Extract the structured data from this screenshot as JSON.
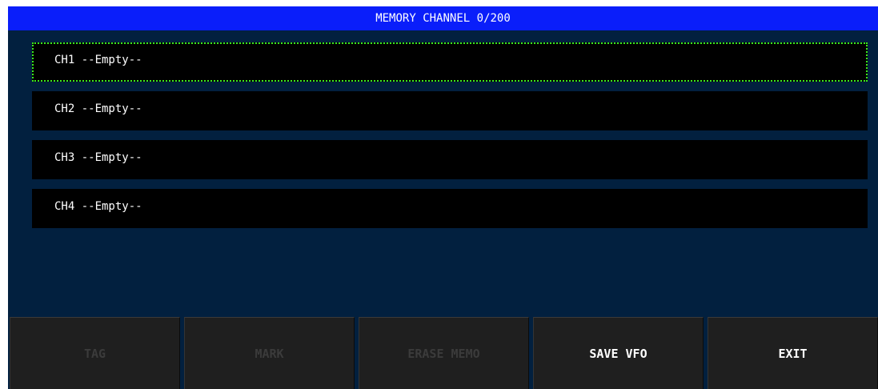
{
  "header": {
    "title": "MEMORY CHANNEL 0/200"
  },
  "channels": [
    {
      "label": "CH1 --Empty--",
      "selected": true
    },
    {
      "label": "CH2 --Empty--",
      "selected": false
    },
    {
      "label": "CH3 --Empty--",
      "selected": false
    },
    {
      "label": "CH4 --Empty--",
      "selected": false
    }
  ],
  "softkeys": {
    "tag": {
      "label": "TAG",
      "enabled": false
    },
    "mark": {
      "label": "MARK",
      "enabled": false
    },
    "erase_memo": {
      "label": "ERASE MEMO",
      "enabled": false
    },
    "save_vfo": {
      "label": "SAVE VFO",
      "enabled": true
    },
    "exit": {
      "label": "EXIT",
      "enabled": true
    }
  },
  "colors": {
    "panel_bg": "#02203f",
    "title_bar": "#0a1efa",
    "selection_outline": "#3ce81a",
    "row_bg": "#000000",
    "softkey_bg": "#1f1f1f",
    "softkey_disabled_text": "#3b3b3b"
  }
}
